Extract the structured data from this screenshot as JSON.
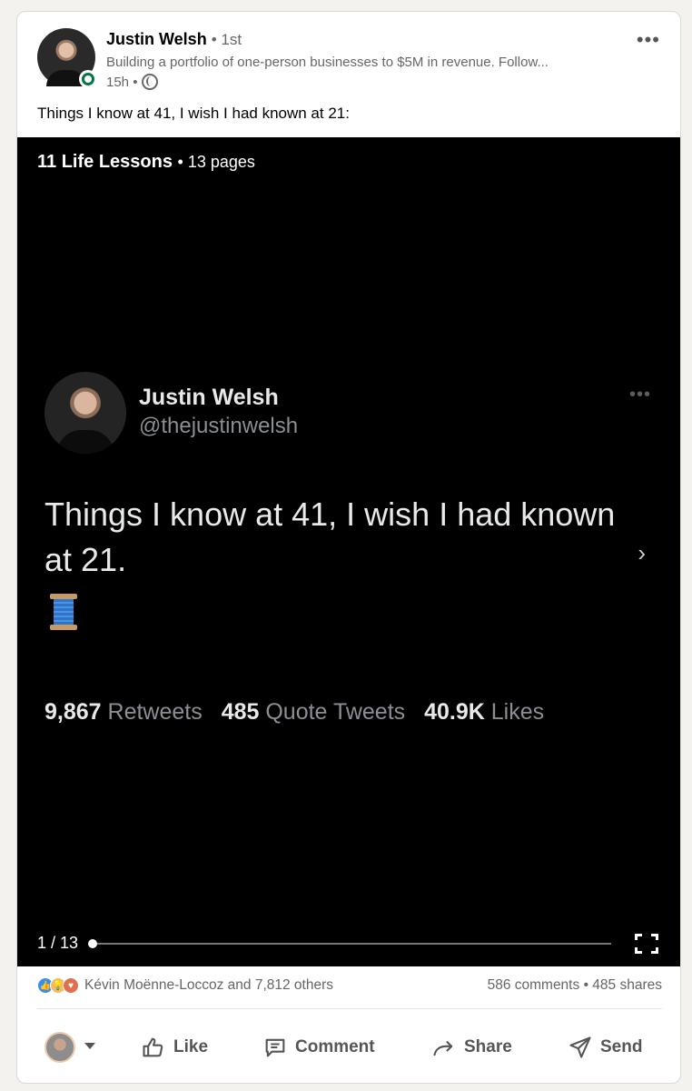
{
  "post": {
    "author": {
      "name": "Justin Welsh",
      "degree": "• 1st",
      "headline": "Building a portfolio of one-person businesses to $5M in revenue. Follow...",
      "time": "15h •"
    },
    "text": "Things I know at 41, I wish I had known at 21:"
  },
  "document": {
    "title": "11 Life Lessons",
    "pages": "• 13 pages",
    "page_counter": "1 / 13",
    "progress": 0.0
  },
  "tweet": {
    "name": "Justin Welsh",
    "handle": "@thejustinwelsh",
    "text": "Things I know at 41, I wish I had known at 21.",
    "emoji": "spool-of-thread",
    "retweets_value": "9,867",
    "retweets_label": "Retweets",
    "quotes_value": "485",
    "quotes_label": "Quote Tweets",
    "likes_value": "40.9K",
    "likes_label": "Likes"
  },
  "social": {
    "reactors": "Kévin Moënne-Loccoz and 7,812 others",
    "comments": "586 comments",
    "shares": "485 shares",
    "reaction_icons": [
      "like-icon",
      "insightful-icon",
      "love-icon"
    ],
    "reaction_colors": {
      "like": "#378fe9",
      "insightful": "#f5bb5c",
      "love": "#df704d"
    }
  },
  "actions": {
    "like": "Like",
    "comment": "Comment",
    "share": "Share",
    "send": "Send"
  },
  "colors": {
    "online": "#057642",
    "carousel_bg": "#000000",
    "muted": "#666666"
  }
}
